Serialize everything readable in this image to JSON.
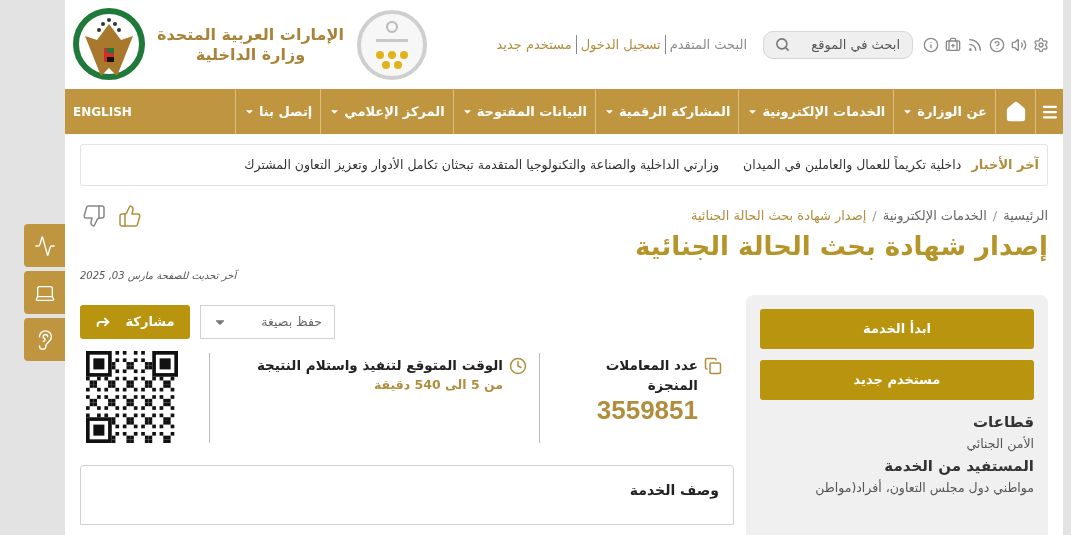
{
  "header": {
    "logo_text": [
      "الإمارات العربية المتحدة",
      "وزارة الداخلية"
    ],
    "tools": [
      {
        "kind": "settings"
      },
      {
        "kind": "speaker"
      },
      {
        "kind": "help"
      },
      {
        "kind": "rss"
      },
      {
        "kind": "briefcase"
      },
      {
        "kind": "info"
      }
    ],
    "search": {
      "placeholder": "ابحث في الموقع"
    },
    "links": [
      {
        "label": "البحث المتقدم",
        "kind": "muted"
      },
      {
        "label": "تسجيل الدخول",
        "kind": "accent"
      },
      {
        "label": "مستخدم جديد",
        "kind": "accent"
      }
    ]
  },
  "nav": {
    "items": [
      {
        "label": "عن الوزارة",
        "dropdown": true
      },
      {
        "label": "الخدمات الإلكترونية",
        "dropdown": true
      },
      {
        "label": "المشاركة الرقمية",
        "dropdown": true
      },
      {
        "label": "البيانات المفتوحة",
        "dropdown": true
      },
      {
        "label": "المركز الإعلامي",
        "dropdown": true
      },
      {
        "label": "إتصل بنا",
        "dropdown": true
      }
    ],
    "language": "ENGLISH"
  },
  "news": {
    "label": "آخر الأخبار",
    "items": [
      "داخلية تكريماً للعمال والعاملين في الميدان",
      "وزارتي الداخلية والصناعة والتكنولوجيا المتقدمة تبحثان تكامل الأدوار وتعزيز التعاون المشترك"
    ]
  },
  "side_tools": [
    {
      "kind": "wave"
    },
    {
      "kind": "laptop"
    },
    {
      "kind": "ear"
    }
  ],
  "breadcrumb": [
    {
      "label": "الرئيسية",
      "separator": "/"
    },
    {
      "label": "الخدمات الإلكترونية",
      "separator": "/"
    },
    {
      "label": "إصدار شهادة بحث الحالة الجنائية"
    }
  ],
  "title": "إصدار شهادة بحث الحالة الجنائية",
  "updated": "آخر تحديث للصفحة مارس 03, 2025",
  "actions": {
    "share": "مشاركة",
    "save": {
      "placeholder": "حفظ بصيغة"
    }
  },
  "stats": [
    {
      "kind": "count",
      "label": "عدد المعاملات المنجزة",
      "value": "3559851"
    },
    {
      "kind": "time",
      "label": "الوقت المتوقع لتنفيذ واستلام النتيجة",
      "value": "من 5 الى 540 دقيقة"
    }
  ],
  "description": {
    "title": "وصف الخدمة"
  },
  "sidebar": {
    "buttons": [
      "ابدأ الخدمة",
      "مستخدم جديد"
    ],
    "sections": [
      {
        "heading": "قطاعات",
        "text": "الأمن الجنائي"
      },
      {
        "heading": "المستفيد من الخدمة",
        "text": "مواطني دول مجلس التعاون، أفراد(مواطن"
      }
    ]
  }
}
